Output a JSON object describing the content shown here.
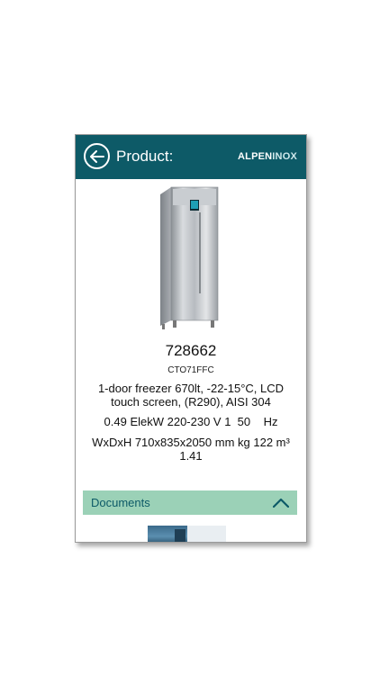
{
  "header": {
    "title": "Product:",
    "logo_part1": "ALPEN",
    "logo_part2": "INOX"
  },
  "product": {
    "code": "728662",
    "model": "CTO71FFC",
    "description": "1-door freezer 670lt, -22-15°C, LCD touch screen, (R290), AISI 304",
    "power": "0.49 ElekW 220-230 V 1  50    Hz",
    "dimensions": "WxDxH 710x835x2050 mm kg 122 m³ 1.41"
  },
  "documents": {
    "label": "Documents"
  },
  "colors": {
    "header_bg": "#0d5a67",
    "documents_bar": "#9bd1b7",
    "accent_text": "#0d5a67"
  },
  "icons": {
    "back": "arrow-left-circle-icon",
    "collapse": "chevron-up-icon"
  }
}
